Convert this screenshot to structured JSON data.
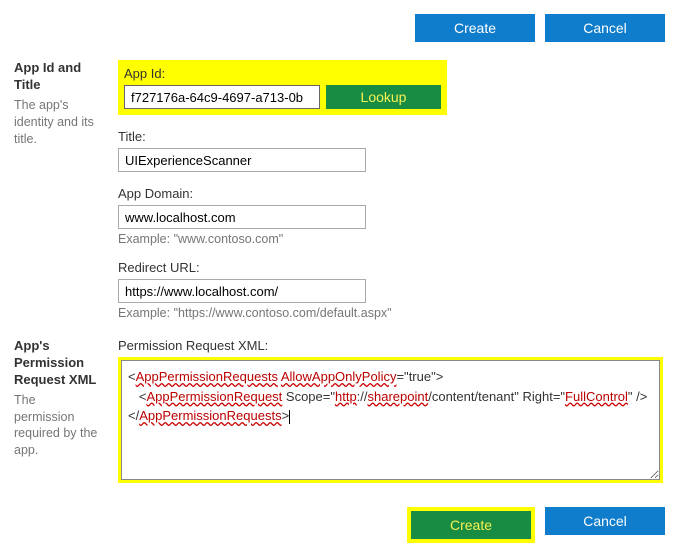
{
  "topButtons": {
    "create": "Create",
    "cancel": "Cancel"
  },
  "section1": {
    "sideTitle": "App Id and Title",
    "sideDesc": "The app's identity and its title.",
    "appId": {
      "label": "App Id:",
      "value": "f727176a-64c9-4697-a713-0b",
      "lookup": "Lookup"
    },
    "title": {
      "label": "Title:",
      "value": "UIExperienceScanner"
    },
    "domain": {
      "label": "App Domain:",
      "value": "www.localhost.com",
      "example": "Example: \"www.contoso.com\""
    },
    "redirect": {
      "label": "Redirect URL:",
      "value": "https://www.localhost.com/",
      "example": "Example: \"https://www.contoso.com/default.aspx\""
    }
  },
  "section2": {
    "sideTitle": "App's Permission Request XML",
    "sideDesc": "The permission required by the app.",
    "label": "Permission Request XML:",
    "xml": {
      "t1": "AppPermissionRequests",
      "attr1": "AllowAppOnlyPolicy",
      "v1": "true",
      "t2": "AppPermissionRequest",
      "attr2a": "Scope",
      "v2a_p1": "http",
      "v2a_p2": "://",
      "v2a_p3": "sharepoint",
      "v2a_p4": "/content/tenant",
      "attr2b": "Right",
      "v2b": "FullControl",
      "t3": "AppPermissionRequests"
    }
  },
  "bottomButtons": {
    "create": "Create",
    "cancel": "Cancel"
  }
}
